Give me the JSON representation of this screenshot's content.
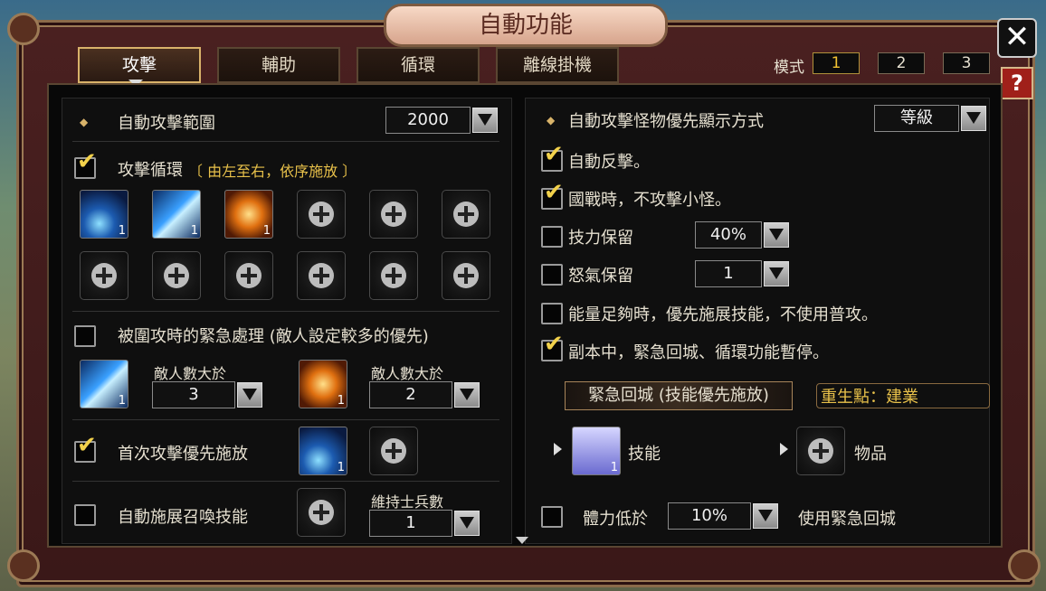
{
  "window": {
    "title": "自動功能",
    "close_glyph": "✕",
    "help_glyph": "?"
  },
  "tabs": [
    {
      "label": "攻擊",
      "active": true
    },
    {
      "label": "輔助"
    },
    {
      "label": "循環"
    },
    {
      "label": "離線掛機"
    }
  ],
  "mode": {
    "label": "模式",
    "options": [
      "1",
      "2",
      "3"
    ],
    "selected": "1"
  },
  "left": {
    "range": {
      "label": "自動攻擊範圍",
      "value": "2000"
    },
    "cycle": {
      "label": "攻擊循環",
      "hint": "〔 由左至右，依序施放 〕",
      "checked": true,
      "slots": [
        {
          "icon": "spear-skill-icon",
          "level": "1"
        },
        {
          "icon": "lightning-skill-icon",
          "level": "1"
        },
        {
          "icon": "fire-arrow-skill-icon",
          "level": "1"
        }
      ]
    },
    "emergency": {
      "label": "被圍攻時的緊急處理 (敵人設定較多的優先)",
      "checked": false,
      "items": [
        {
          "icon": "lightning-skill-icon",
          "level": "1",
          "label": "敵人數大於",
          "value": "3"
        },
        {
          "icon": "fire-arrow-skill-icon",
          "level": "1",
          "label": "敵人數大於",
          "value": "2"
        }
      ]
    },
    "first_attack": {
      "label": "首次攻擊優先施放",
      "checked": true,
      "icon": "spear-skill-icon",
      "level": "1"
    },
    "summon": {
      "label": "自動施展召喚技能",
      "checked": false,
      "count_label": "維持士兵數",
      "count_value": "1"
    }
  },
  "right": {
    "priority": {
      "label": "自動攻擊怪物優先顯示方式",
      "value": "等級"
    },
    "counter": {
      "label": "自動反擊。",
      "checked": true
    },
    "nation_war": {
      "label": "國戰時，不攻擊小怪。",
      "checked": true
    },
    "skill_reserve": {
      "label": "技力保留",
      "checked": false,
      "value": "40%"
    },
    "rage_reserve": {
      "label": "怒氣保留",
      "checked": false,
      "value": "1"
    },
    "energy": {
      "label": "能量足夠時，優先施展技能，不使用普攻。",
      "checked": false
    },
    "dungeon": {
      "label": "副本中，緊急回城、循環功能暫停。",
      "checked": true
    },
    "return": {
      "banner": "緊急回城 (技能優先施放)",
      "respawn": "重生點：建業",
      "skill_label": "技能",
      "skill_level": "1",
      "item_label": "物品"
    },
    "hp_low": {
      "label": "體力低於",
      "value": "10%",
      "action": "使用緊急回城",
      "checked": false
    }
  },
  "colors": {
    "accent": "#e8c14a",
    "frame": "#4a2020",
    "help": "#a0201a"
  }
}
